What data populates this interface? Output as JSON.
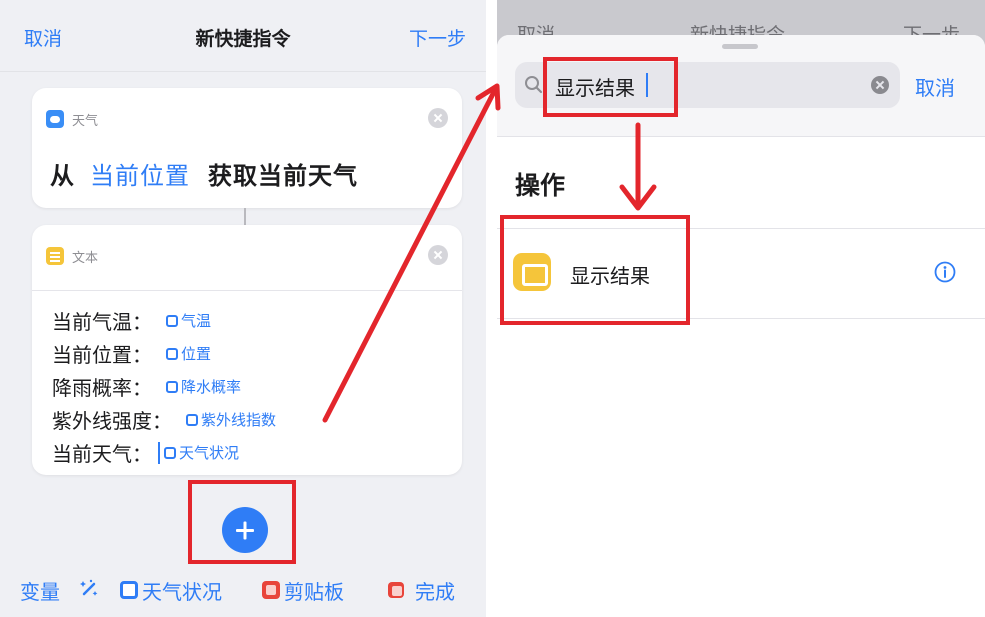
{
  "left": {
    "nav": {
      "cancel": "取消",
      "title": "新快捷指令",
      "next": "下一步"
    },
    "weather_card": {
      "app": "天气",
      "prefix": "从",
      "param": "当前位置",
      "action": "获取当前天气"
    },
    "text_card": {
      "app": "文本",
      "lines": [
        {
          "label": "当前气温：",
          "token": "气温"
        },
        {
          "label": "当前位置：",
          "token": "位置"
        },
        {
          "label": "降雨概率：",
          "token": "降水概率"
        },
        {
          "label": "紫外线强度：",
          "token": "紫外线指数"
        },
        {
          "label": "当前天气：",
          "token": "天气状况"
        }
      ]
    },
    "toolbar": {
      "variables": "变量",
      "var_weather": "天气状况",
      "var_clipboard": "剪贴板",
      "done": "完成"
    }
  },
  "right": {
    "background_nav": {
      "cancel": "取消",
      "title": "新快捷指令",
      "next": "下一步"
    },
    "search": {
      "value": "显示结果",
      "cancel": "取消"
    },
    "section": "操作",
    "result": {
      "label": "显示结果"
    }
  },
  "icons": {
    "weather_app": "weather-icon",
    "text_app": "text-icon",
    "remove": "close-icon",
    "add": "plus-icon",
    "magic": "magic-wand-icon",
    "search": "search-icon",
    "clear": "clear-icon",
    "info": "info-icon",
    "show_result": "show-result-icon"
  },
  "colors": {
    "accent": "#2f7df6",
    "annotation": "#e3262c",
    "weather_icon": "#3a8ef6",
    "text_icon": "#f5c53a",
    "clipboard_icon": "#e8443a"
  }
}
